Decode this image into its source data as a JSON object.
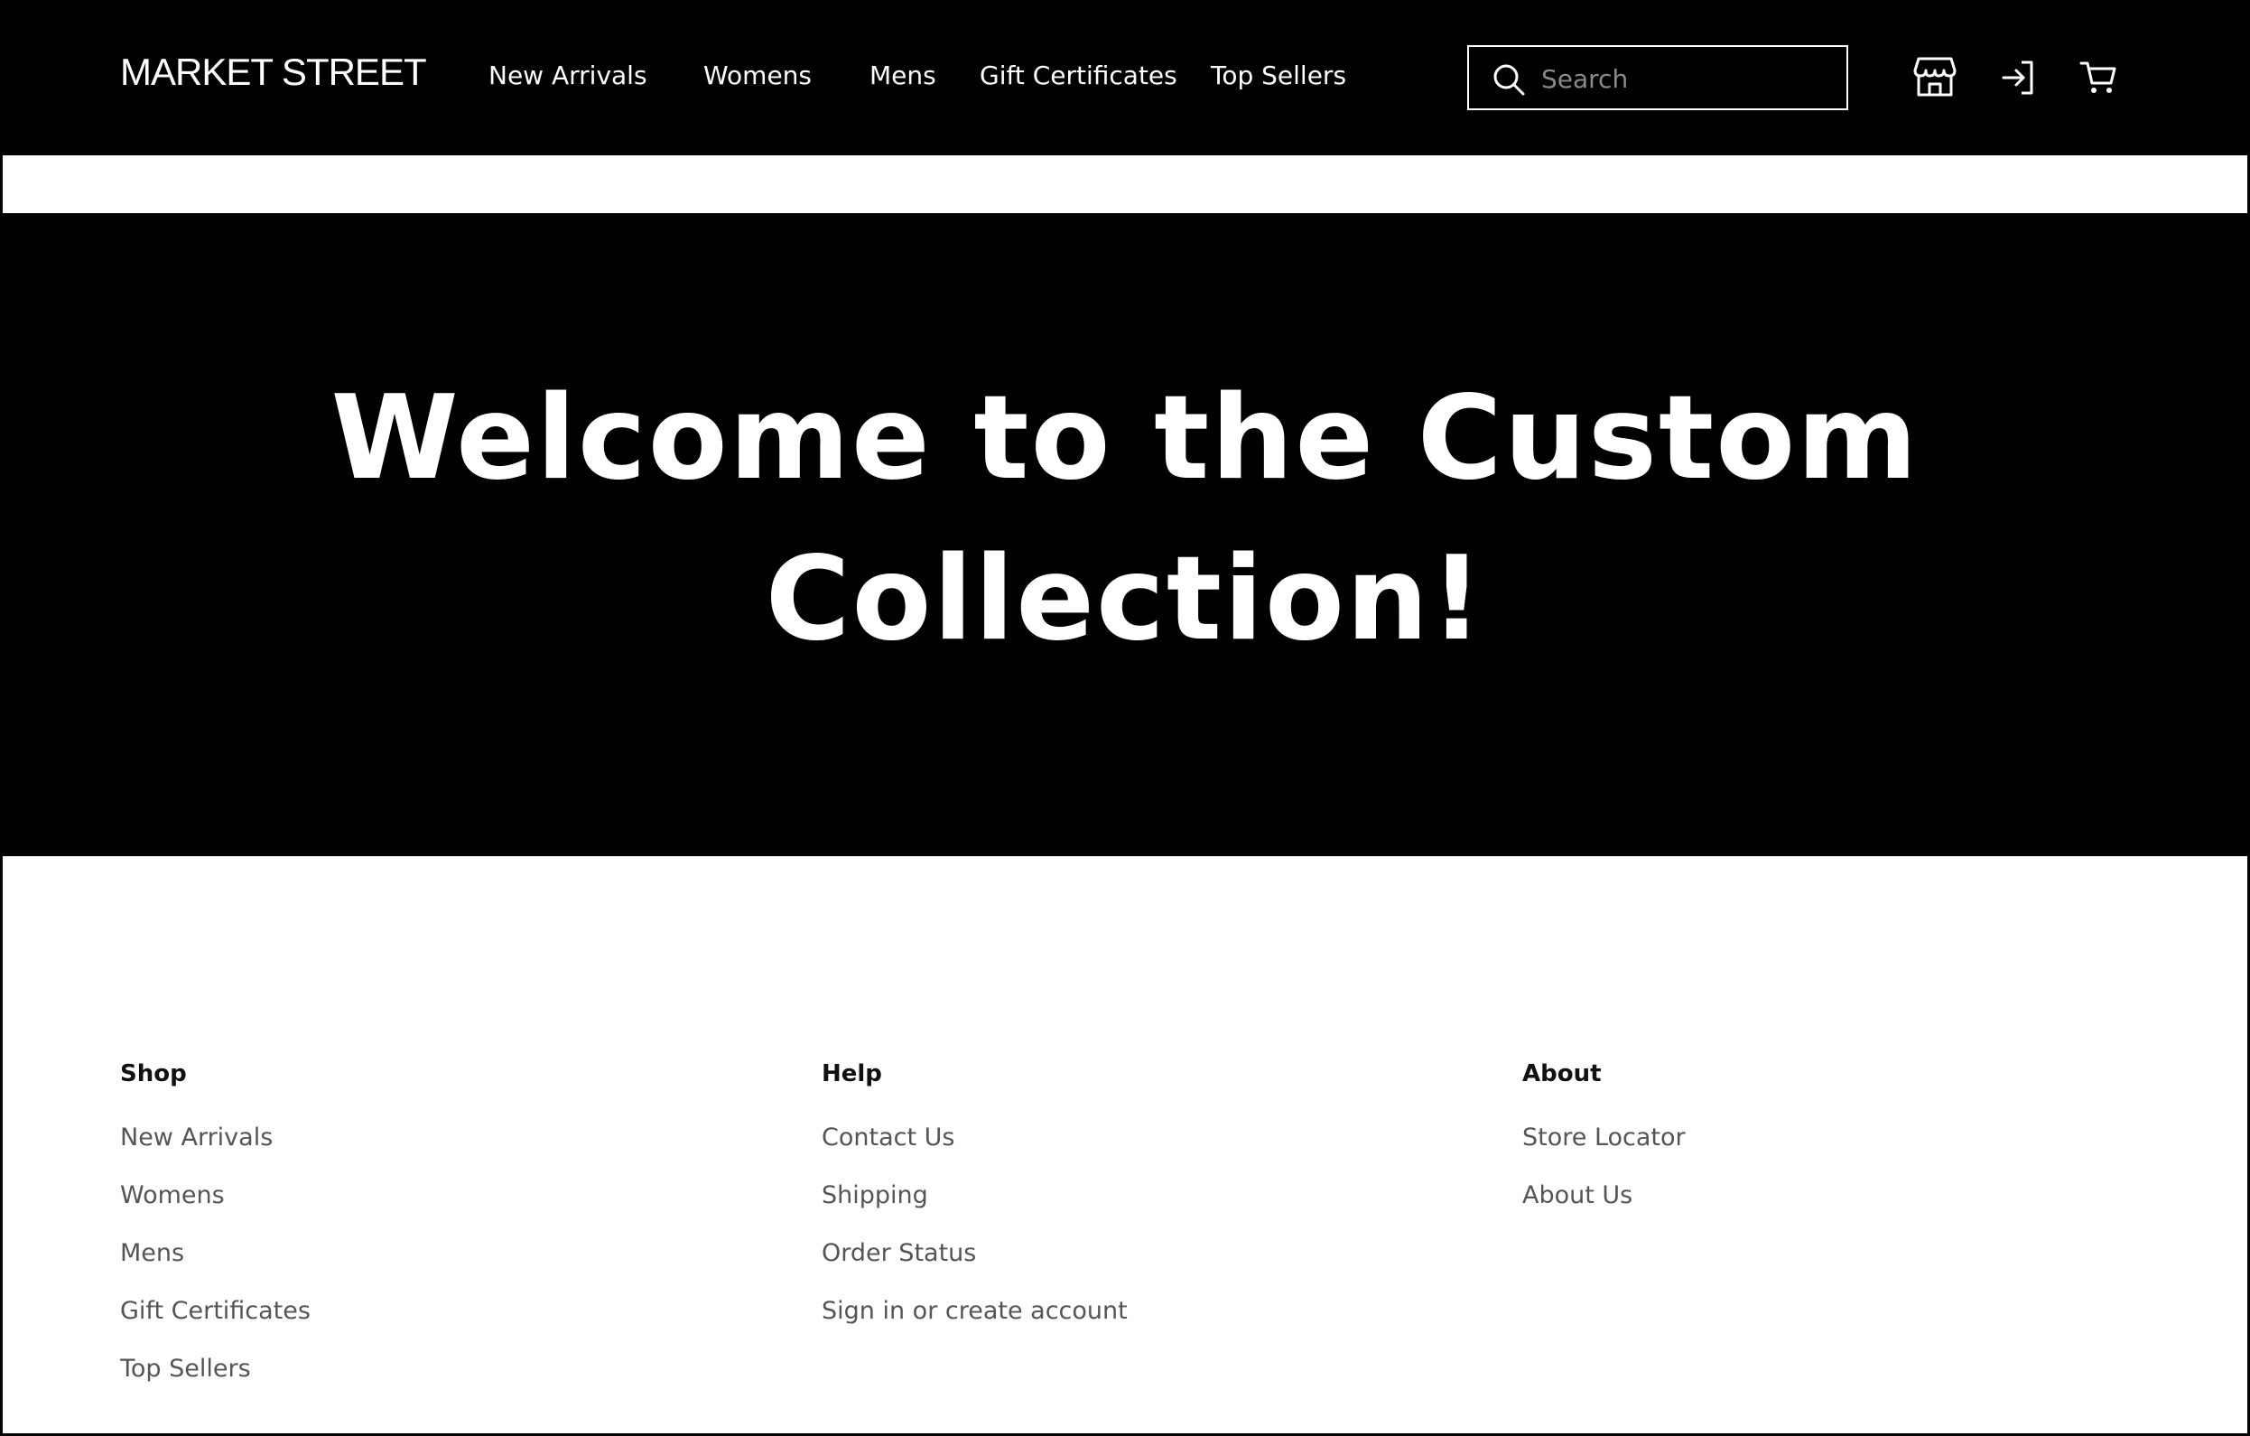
{
  "header": {
    "logo": "MARKET STREET",
    "nav": [
      {
        "label": "New Arrivals"
      },
      {
        "label": "Womens"
      },
      {
        "label": "Mens"
      },
      {
        "label": "Gift Certificates"
      },
      {
        "label": "Top Sellers"
      }
    ],
    "search": {
      "placeholder": "Search",
      "value": ""
    },
    "icons": [
      "store-icon",
      "sign-in-icon",
      "cart-icon"
    ]
  },
  "hero": {
    "title": "Welcome to the Custom Collection!"
  },
  "footer": {
    "columns": [
      {
        "title": "Shop",
        "links": [
          "New Arrivals",
          "Womens",
          "Mens",
          "Gift Certificates",
          "Top Sellers"
        ]
      },
      {
        "title": "Help",
        "links": [
          "Contact Us",
          "Shipping",
          "Order Status",
          "Sign in or create account"
        ]
      },
      {
        "title": "About",
        "links": [
          "Store Locator",
          "About Us"
        ]
      }
    ]
  },
  "colors": {
    "header_bg": "#000000",
    "hero_bg": "#000000",
    "link_gray": "#555555"
  }
}
